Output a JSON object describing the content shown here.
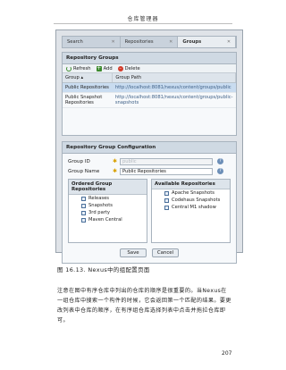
{
  "page": {
    "header": "仓库管理器",
    "caption": "图 16.13. Nexus中的组配置页面",
    "paragraph": "注意在图中有序仓库中列出的仓库的顺序是很重要的。当Nexus在一组仓库中搜索一个构件的时候，它会返回第一个匹配的结果。要更改列表中仓库的顺序，在有序组仓库选择列表中点击并拖拉仓库即可。",
    "page_number": "207"
  },
  "tabs": [
    {
      "label": "Search",
      "active": false
    },
    {
      "label": "Repositories",
      "active": false
    },
    {
      "label": "Groups",
      "active": true
    }
  ],
  "groups_panel": {
    "title": "Repository Groups",
    "toolbar": {
      "refresh": "Refresh",
      "add": "Add",
      "delete": "Delete"
    },
    "columns": [
      "Group",
      "Group Path"
    ],
    "rows": [
      {
        "group": "Public Repositories",
        "path": "http://localhost:8081/nexus/content/groups/public",
        "selected": true
      },
      {
        "group": "Public Snapshot Repositories",
        "path": "http://localhost:8081/nexus/content/groups/public-snapshots",
        "selected": false
      }
    ]
  },
  "config_panel": {
    "title": "Repository Group Configuration",
    "group_id_label": "Group ID",
    "group_id_value": "public",
    "group_name_label": "Group Name",
    "group_name_value": "Public Repositories",
    "ordered_title": "Ordered Group Repositories",
    "ordered": [
      "Releases",
      "Snapshots",
      "3rd party",
      "Maven Central"
    ],
    "available_title": "Available Repositories",
    "available": [
      "Apache Snapshots",
      "Codehaus Snapshots",
      "Central M1 shadow"
    ],
    "save": "Save",
    "cancel": "Cancel"
  },
  "colors": {
    "selected_row": "#c9dcf0",
    "header_bg": "#cfd9e3",
    "required_star": "#d8a000"
  },
  "icons": [
    "close-icon",
    "refresh-icon",
    "add-icon",
    "delete-icon",
    "sort-asc-icon",
    "help-icon",
    "repository-icon"
  ]
}
